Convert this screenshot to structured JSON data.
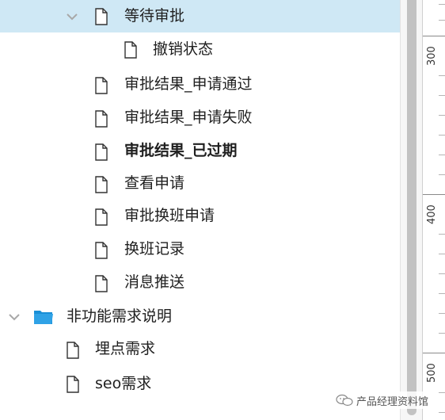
{
  "tree": {
    "items": [
      {
        "label": "等待审批",
        "type": "page",
        "expanded": true,
        "selected": true
      },
      {
        "label": "撤销状态",
        "type": "page"
      },
      {
        "label": "审批结果_申请通过",
        "type": "page"
      },
      {
        "label": "审批结果_申请失败",
        "type": "page"
      },
      {
        "label": "审批结果_已过期",
        "type": "page",
        "bold": true
      },
      {
        "label": "查看申请",
        "type": "page"
      },
      {
        "label": "审批换班申请",
        "type": "page"
      },
      {
        "label": "换班记录",
        "type": "page"
      },
      {
        "label": "消息推送",
        "type": "page"
      },
      {
        "label": "非功能需求说明",
        "type": "folder",
        "expanded": true
      },
      {
        "label": "埋点需求",
        "type": "page"
      },
      {
        "label": "seo需求",
        "type": "page"
      }
    ]
  },
  "ruler": {
    "labels": [
      "300",
      "400",
      "500"
    ]
  },
  "watermark": {
    "text": "产品经理资料馆",
    "icon": "wechat-icon"
  },
  "colors": {
    "selected_row": "#cfe8f5",
    "folder": "#1a8fd6"
  }
}
